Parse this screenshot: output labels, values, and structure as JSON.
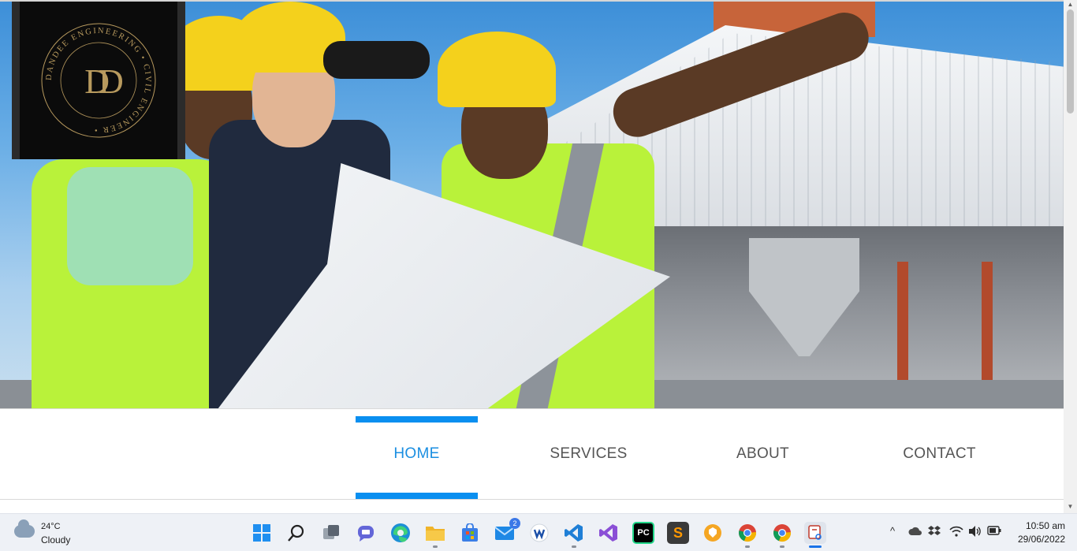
{
  "logo": {
    "monogram": "DD",
    "ring_text": "DANDEE ENGINEERING • CIVIL ENGINEER •"
  },
  "nav": {
    "items": [
      {
        "label": "HOME",
        "active": true
      },
      {
        "label": "SERVICES",
        "active": false
      },
      {
        "label": "ABOUT",
        "active": false
      },
      {
        "label": "CONTACT",
        "active": false
      }
    ]
  },
  "colors": {
    "accent": "#0a8ff0",
    "nav_text": "#555555",
    "logo_bg": "#0b0b0b",
    "logo_gold": "#b89a5e"
  },
  "taskbar": {
    "weather": {
      "temp": "24°C",
      "condition": "Cloudy",
      "icon": "cloud-icon"
    },
    "apps": [
      {
        "name": "windows-start",
        "icon": "windows-logo-icon"
      },
      {
        "name": "search",
        "icon": "search-icon"
      },
      {
        "name": "task-view",
        "icon": "task-view-icon"
      },
      {
        "name": "teams-chat",
        "icon": "chat-icon"
      },
      {
        "name": "edge",
        "icon": "edge-icon"
      },
      {
        "name": "file-explorer",
        "icon": "folder-icon"
      },
      {
        "name": "microsoft-store",
        "icon": "store-icon"
      },
      {
        "name": "mail",
        "icon": "mail-icon",
        "badge": "2"
      },
      {
        "name": "wps",
        "icon": "wps-icon"
      },
      {
        "name": "vscode",
        "icon": "vscode-icon"
      },
      {
        "name": "visual-studio",
        "icon": "visual-studio-icon"
      },
      {
        "name": "pycharm",
        "icon": "pycharm-icon",
        "text": "PC"
      },
      {
        "name": "sublime-text",
        "icon": "sublime-icon",
        "text": "S"
      },
      {
        "name": "brave",
        "icon": "brave-icon"
      },
      {
        "name": "chrome",
        "icon": "chrome-icon"
      },
      {
        "name": "chrome-profile",
        "icon": "chrome-icon"
      },
      {
        "name": "snipping-tool",
        "icon": "snipping-tool-icon"
      }
    ],
    "tray": {
      "chevron": "^",
      "icons": [
        "onedrive-icon",
        "dropbox-icon",
        "wifi-icon",
        "volume-icon",
        "battery-icon"
      ]
    },
    "clock": {
      "time": "10:50 am",
      "date": "29/06/2022"
    }
  }
}
